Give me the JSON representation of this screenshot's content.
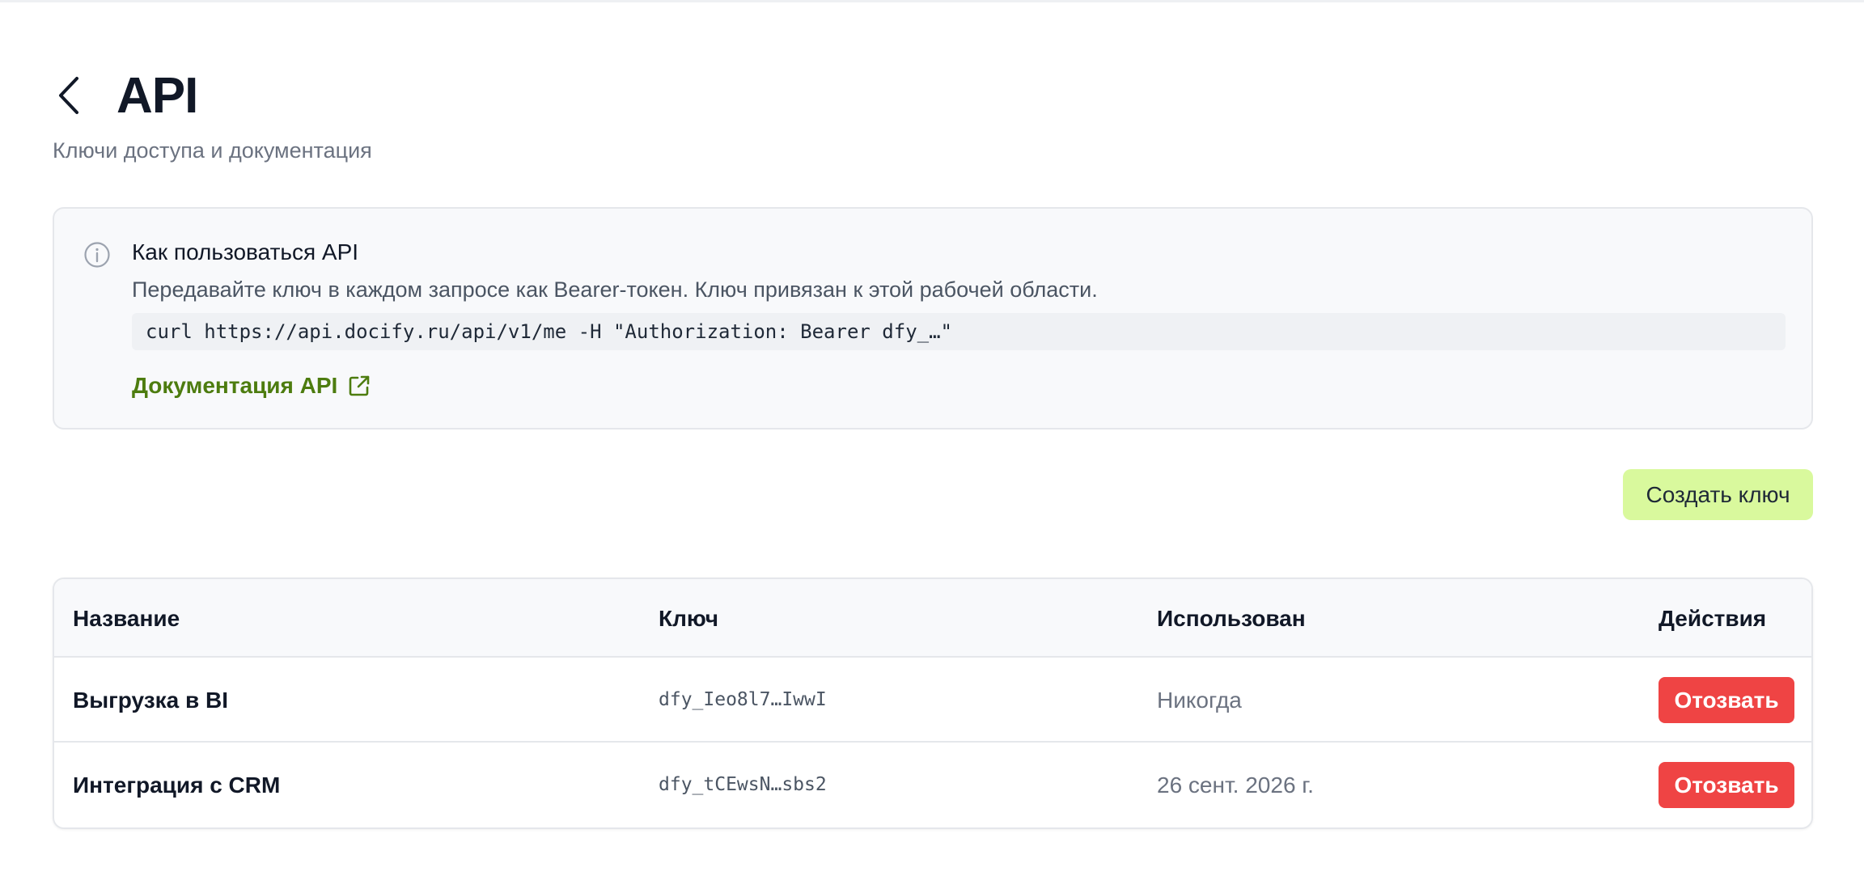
{
  "header": {
    "title": "API",
    "subtitle": "Ключи доступа и документация",
    "back_icon": "chevron-left-icon"
  },
  "info": {
    "icon": "info-circle-icon",
    "heading": "Как пользоваться API",
    "text": "Передавайте ключ в каждом запросе как Bearer-токен. Ключ привязан к этой рабочей области.",
    "code": "curl https://api.docify.ru/api/v1/me -H \"Authorization: Bearer dfy_…\"",
    "docs_link_label": "Документация API",
    "docs_link_icon": "external-link-icon",
    "link_color": "#4d7c0f"
  },
  "actions": {
    "create_key_label": "Создать ключ",
    "create_key_color": "#d9f99d"
  },
  "table": {
    "columns": {
      "name": "Название",
      "key": "Ключ",
      "used": "Использован",
      "actions": "Действия"
    },
    "rows": [
      {
        "name": "Выгрузка в BI",
        "key": "dfy_Ieo8l7…IwwI",
        "used": "Никогда",
        "action": "Отозвать"
      },
      {
        "name": "Интеграция с CRM",
        "key": "dfy_tCEwsN…sbs2",
        "used": "26 сент. 2026 г.",
        "action": "Отозвать"
      }
    ],
    "revoke_color": "#ef4444"
  }
}
